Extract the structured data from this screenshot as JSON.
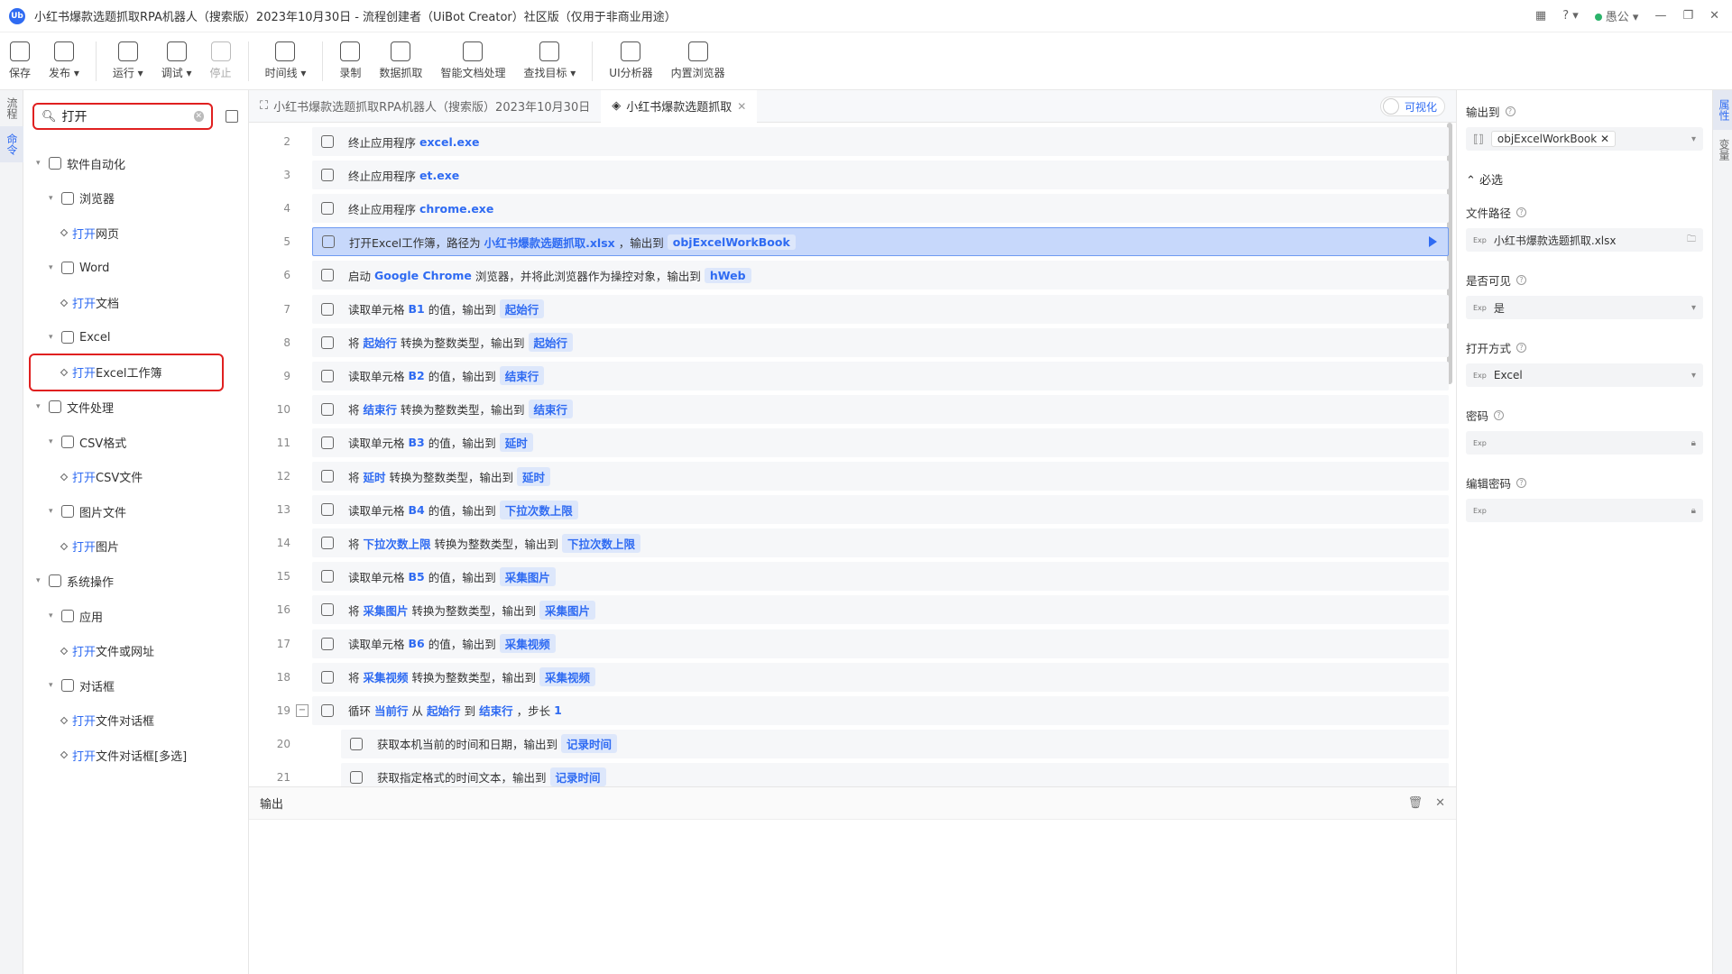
{
  "window": {
    "title": "小红书爆款选题抓取RPA机器人（搜索版）2023年10月30日 - 流程创建者（UiBot Creator）社区版（仅用于非商业用途）",
    "logo": "Ub",
    "user": "愚公"
  },
  "toolbar": [
    {
      "label": "保存",
      "icon": "save-icon"
    },
    {
      "label": "发布 ▾",
      "icon": "send-icon"
    },
    {
      "label": "运行 ▾",
      "icon": "run-icon"
    },
    {
      "label": "调试 ▾",
      "icon": "debug-icon"
    },
    {
      "label": "停止",
      "icon": "stop-icon"
    },
    {
      "label": "时间线 ▾",
      "icon": "clock-icon"
    },
    {
      "label": "录制",
      "icon": "record-icon"
    },
    {
      "label": "数据抓取",
      "icon": "data-scrape-icon"
    },
    {
      "label": "智能文档处理",
      "icon": "ai-doc-icon"
    },
    {
      "label": "查找目标 ▾",
      "icon": "find-target-icon"
    },
    {
      "label": "UI分析器",
      "icon": "ui-analyzer-icon"
    },
    {
      "label": "内置浏览器",
      "icon": "browser-icon"
    }
  ],
  "leftrail": {
    "tab1": "流程",
    "tab2": "命令"
  },
  "search": {
    "value": "打开"
  },
  "tree": [
    {
      "label": "软件自动化",
      "level": 1
    },
    {
      "label": "浏览器",
      "level": 2
    },
    {
      "pre": "打开",
      "post": "网页",
      "level": 3
    },
    {
      "label": "Word",
      "level": 2
    },
    {
      "pre": "打开",
      "post": "文档",
      "level": 3
    },
    {
      "label": "Excel",
      "level": 2
    },
    {
      "pre": "打开",
      "post": "Excel工作簿",
      "level": 3,
      "boxed": true
    },
    {
      "label": "文件处理",
      "level": 1
    },
    {
      "label": "CSV格式",
      "level": 2
    },
    {
      "pre": "打开",
      "post": "CSV文件",
      "level": 3
    },
    {
      "label": "图片文件",
      "level": 2
    },
    {
      "pre": "打开",
      "post": "图片",
      "level": 3
    },
    {
      "label": "系统操作",
      "level": 1
    },
    {
      "label": "应用",
      "level": 2
    },
    {
      "pre": "打开",
      "post": "文件或网址",
      "level": 3
    },
    {
      "label": "对话框",
      "level": 2
    },
    {
      "pre": "打开",
      "post": "文件对话框",
      "level": 3
    },
    {
      "pre": "打开",
      "post": "文件对话框[多选]",
      "level": 3
    }
  ],
  "tabs": [
    {
      "label": "小红书爆款选题抓取RPA机器人（搜索版）2023年10月30日"
    },
    {
      "label": "小红书爆款选题抓取"
    }
  ],
  "viz_label": "可视化",
  "lines": [
    {
      "n": "2",
      "parts": [
        [
          "t",
          "终止应用程序"
        ],
        [
          "b",
          "excel.exe"
        ]
      ]
    },
    {
      "n": "3",
      "parts": [
        [
          "t",
          "终止应用程序"
        ],
        [
          "b",
          "et.exe"
        ]
      ]
    },
    {
      "n": "4",
      "parts": [
        [
          "t",
          "终止应用程序"
        ],
        [
          "b",
          "chrome.exe"
        ]
      ]
    },
    {
      "n": "5",
      "sel": true,
      "parts": [
        [
          "t",
          "打开Excel工作簿，路径为"
        ],
        [
          "b",
          "小红书爆款选题抓取.xlsx"
        ],
        [
          "t",
          "，输出到"
        ],
        [
          "g",
          "objExcelWorkBook"
        ]
      ]
    },
    {
      "n": "6",
      "parts": [
        [
          "t",
          "启动"
        ],
        [
          "b",
          "Google Chrome"
        ],
        [
          "t",
          "浏览器，并将此浏览器作为操控对象，输出到"
        ],
        [
          "g",
          "hWeb"
        ]
      ]
    },
    {
      "n": "7",
      "parts": [
        [
          "t",
          "读取单元格"
        ],
        [
          "b",
          "B1"
        ],
        [
          "t",
          "的值，输出到"
        ],
        [
          "g",
          "起始行"
        ]
      ]
    },
    {
      "n": "8",
      "parts": [
        [
          "t",
          "将"
        ],
        [
          "b",
          "起始行"
        ],
        [
          "t",
          "转换为整数类型，输出到"
        ],
        [
          "g",
          "起始行"
        ]
      ]
    },
    {
      "n": "9",
      "parts": [
        [
          "t",
          "读取单元格"
        ],
        [
          "b",
          "B2"
        ],
        [
          "t",
          "的值，输出到"
        ],
        [
          "g",
          "结束行"
        ]
      ]
    },
    {
      "n": "10",
      "parts": [
        [
          "t",
          "将"
        ],
        [
          "b",
          "结束行"
        ],
        [
          "t",
          "转换为整数类型，输出到"
        ],
        [
          "g",
          "结束行"
        ]
      ]
    },
    {
      "n": "11",
      "parts": [
        [
          "t",
          "读取单元格"
        ],
        [
          "b",
          "B3"
        ],
        [
          "t",
          "的值，输出到"
        ],
        [
          "g",
          "延时"
        ]
      ]
    },
    {
      "n": "12",
      "parts": [
        [
          "t",
          "将"
        ],
        [
          "b",
          "延时"
        ],
        [
          "t",
          "转换为整数类型，输出到"
        ],
        [
          "g",
          "延时"
        ]
      ]
    },
    {
      "n": "13",
      "parts": [
        [
          "t",
          "读取单元格"
        ],
        [
          "b",
          "B4"
        ],
        [
          "t",
          "的值，输出到"
        ],
        [
          "g",
          "下拉次数上限"
        ]
      ]
    },
    {
      "n": "14",
      "parts": [
        [
          "t",
          "将"
        ],
        [
          "b",
          "下拉次数上限"
        ],
        [
          "t",
          "转换为整数类型，输出到"
        ],
        [
          "g",
          "下拉次数上限"
        ]
      ]
    },
    {
      "n": "15",
      "parts": [
        [
          "t",
          "读取单元格"
        ],
        [
          "b",
          "B5"
        ],
        [
          "t",
          "的值，输出到"
        ],
        [
          "g",
          "采集图片"
        ]
      ]
    },
    {
      "n": "16",
      "parts": [
        [
          "t",
          "将"
        ],
        [
          "b",
          "采集图片"
        ],
        [
          "t",
          "转换为整数类型，输出到"
        ],
        [
          "g",
          "采集图片"
        ]
      ]
    },
    {
      "n": "17",
      "parts": [
        [
          "t",
          "读取单元格"
        ],
        [
          "b",
          "B6"
        ],
        [
          "t",
          "的值，输出到"
        ],
        [
          "g",
          "采集视频"
        ]
      ]
    },
    {
      "n": "18",
      "parts": [
        [
          "t",
          "将"
        ],
        [
          "b",
          "采集视频"
        ],
        [
          "t",
          "转换为整数类型，输出到"
        ],
        [
          "g",
          "采集视频"
        ]
      ]
    },
    {
      "n": "19",
      "fold": true,
      "parts": [
        [
          "t",
          "循环"
        ],
        [
          "b",
          "当前行"
        ],
        [
          "t",
          "从"
        ],
        [
          "b",
          "起始行"
        ],
        [
          "t",
          "到"
        ],
        [
          "b",
          "结束行"
        ],
        [
          "t",
          "，步长"
        ],
        [
          "b",
          "1"
        ]
      ]
    },
    {
      "n": "20",
      "indent": true,
      "parts": [
        [
          "t",
          "获取本机当前的时间和日期，输出到"
        ],
        [
          "g",
          "记录时间"
        ]
      ]
    },
    {
      "n": "21",
      "indent": true,
      "parts": [
        [
          "t",
          "获取指定格式的时间文本，输出到"
        ],
        [
          "g",
          "记录时间"
        ]
      ]
    }
  ],
  "output": {
    "title": "输出"
  },
  "props": {
    "output_to_label": "输出到",
    "output_to_value": "objExcelWorkBook",
    "required_section": "必选",
    "file_path_label": "文件路径",
    "file_path_value": "小红书爆款选题抓取.xlsx",
    "visible_label": "是否可见",
    "visible_value": "是",
    "open_mode_label": "打开方式",
    "open_mode_value": "Excel",
    "password_label": "密码",
    "edit_password_label": "编辑密码",
    "exp": "Exp"
  },
  "rightrail": {
    "tab1": "属性",
    "tab2": "变量"
  }
}
